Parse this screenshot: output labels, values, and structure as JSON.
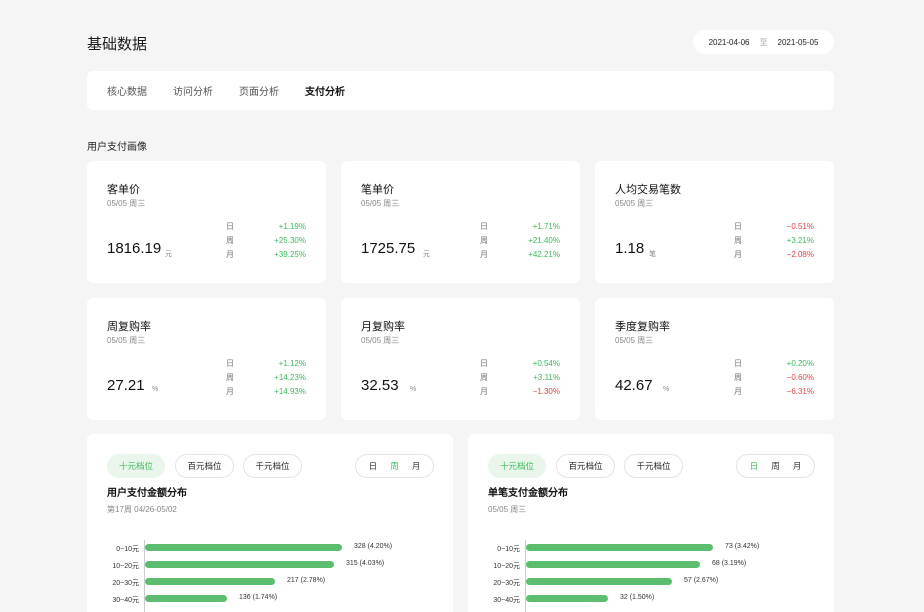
{
  "header": {
    "title": "基础数据",
    "date_from": "2021-04-06",
    "date_sep": "至",
    "date_to": "2021-05-05"
  },
  "tabs": [
    {
      "label": "核心数据",
      "active": false
    },
    {
      "label": "访问分析",
      "active": false
    },
    {
      "label": "页面分析",
      "active": false
    },
    {
      "label": "支付分析",
      "active": true
    }
  ],
  "section_title": "用户支付画像",
  "cards": [
    {
      "title": "客单价",
      "date": "05/05 周三",
      "value": "1816.19",
      "unit": "元",
      "changes": [
        {
          "label": "日",
          "value": "+1.19%"
        },
        {
          "label": "周",
          "value": "+25.30%"
        },
        {
          "label": "月",
          "value": "+39.25%"
        }
      ]
    },
    {
      "title": "笔单价",
      "date": "05/05 周三",
      "value": "1725.75",
      "unit": "元",
      "changes": [
        {
          "label": "日",
          "value": "+1.71%"
        },
        {
          "label": "周",
          "value": "+21.40%"
        },
        {
          "label": "月",
          "value": "+42.21%"
        }
      ]
    },
    {
      "title": "人均交易笔数",
      "date": "05/05 周三",
      "value": "1.18",
      "unit": "笔",
      "changes": [
        {
          "label": "日",
          "value": "−0.51%"
        },
        {
          "label": "周",
          "value": "+3.21%"
        },
        {
          "label": "月",
          "value": "−2.08%"
        }
      ]
    },
    {
      "title": "周复购率",
      "date": "05/05 周三",
      "value": "27.21",
      "unit": "%",
      "changes": [
        {
          "label": "日",
          "value": "+1.12%"
        },
        {
          "label": "周",
          "value": "+14.23%"
        },
        {
          "label": "月",
          "value": "+14.93%"
        }
      ]
    },
    {
      "title": "月复购率",
      "date": "05/05 周三",
      "value": "32.53",
      "unit": "%",
      "changes": [
        {
          "label": "日",
          "value": "+0.54%"
        },
        {
          "label": "周",
          "value": "+3.11%"
        },
        {
          "label": "月",
          "value": "−1.30%"
        }
      ]
    },
    {
      "title": "季度复购率",
      "date": "05/05 周三",
      "value": "42.67",
      "unit": "%",
      "changes": [
        {
          "label": "日",
          "value": "+0.20%"
        },
        {
          "label": "周",
          "value": "−0.60%"
        },
        {
          "label": "月",
          "value": "−6.31%"
        }
      ]
    }
  ],
  "panels": [
    {
      "segments": [
        {
          "label": "十元档位",
          "active": true
        },
        {
          "label": "百元档位",
          "active": false
        },
        {
          "label": "千元档位",
          "active": false
        }
      ],
      "periods": [
        {
          "label": "日",
          "active": false
        },
        {
          "label": "周",
          "active": true
        },
        {
          "label": "月",
          "active": false
        }
      ],
      "title": "用户支付金额分布",
      "subtitle": "第17周 04/26-05/02"
    },
    {
      "segments": [
        {
          "label": "十元档位",
          "active": true
        },
        {
          "label": "百元档位",
          "active": false
        },
        {
          "label": "千元档位",
          "active": false
        }
      ],
      "periods": [
        {
          "label": "日",
          "active": true
        },
        {
          "label": "周",
          "active": false
        },
        {
          "label": "月",
          "active": false
        }
      ],
      "title": "单笔支付金额分布",
      "subtitle": "05/05 周三"
    }
  ],
  "chart_data": [
    {
      "type": "bar",
      "orientation": "horizontal",
      "categories": [
        "0~10元",
        "10~20元",
        "20~30元",
        "30~40元"
      ],
      "values": [
        328,
        315,
        217,
        136
      ],
      "labels": [
        "328 (4.20%)",
        "315 (4.03%)",
        "217 (2.78%)",
        "136 (1.74%)"
      ],
      "xlim": [
        0,
        328
      ]
    },
    {
      "type": "bar",
      "orientation": "horizontal",
      "categories": [
        "0~10元",
        "10~20元",
        "20~30元",
        "30~40元"
      ],
      "values": [
        73,
        68,
        57,
        32
      ],
      "labels": [
        "73 (3.42%)",
        "68 (3.19%)",
        "57 (2.67%)",
        "32 (1.50%)"
      ],
      "xlim": [
        0,
        75
      ]
    }
  ],
  "colors": {
    "up": "#3cb95a",
    "down": "#e24545",
    "bar": "#5cbd6e",
    "accent_bg": "#eaf6ec"
  }
}
